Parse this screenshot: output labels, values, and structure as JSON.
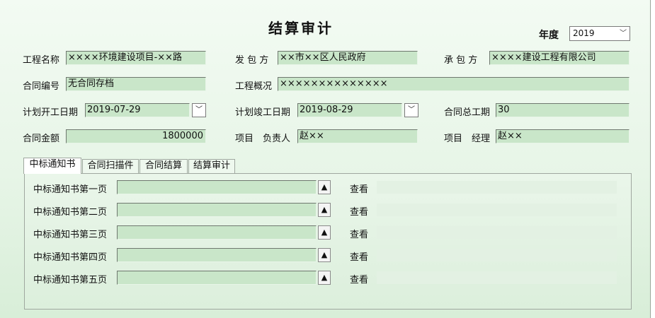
{
  "title": "结算审计",
  "year": {
    "label": "年度",
    "value": "2019"
  },
  "form": {
    "project_name_label": "工程名称",
    "project_name": "××××环境建设项目-××路",
    "client_label": "发 包 方",
    "client": "××市××区人民政府",
    "contractor_label": "承 包 方",
    "contractor": "××××建设工程有限公司",
    "contract_no_label": "合同编号",
    "contract_no": "无合同存档",
    "overview_label": "工程概况",
    "overview": "××××××××××××××",
    "start_label": "计划开工日期",
    "start_date": "2019-07-29",
    "end_label": "计划竣工日期",
    "end_date": "2019-08-29",
    "duration_label": "合同总工期",
    "duration": "30",
    "amount_label": "合同金额",
    "amount": "1800000",
    "owner_label": "项目　负责人",
    "owner": "赵××",
    "manager_label": "项目　经理",
    "manager": "赵××"
  },
  "tabs": [
    "中标通知书",
    "合同扫描件",
    "合同结算",
    "结算审计"
  ],
  "rows": [
    {
      "label": "中标通知书第一页",
      "view": "查看"
    },
    {
      "label": "中标通知书第二页",
      "view": "查看"
    },
    {
      "label": "中标通知书第三页",
      "view": "查看"
    },
    {
      "label": "中标通知书第四页",
      "view": "查看"
    },
    {
      "label": "中标通知书第五页",
      "view": "查看"
    }
  ],
  "icons": {
    "dropdown": "chevron-down-icon",
    "upload": "triangle-up-icon"
  }
}
